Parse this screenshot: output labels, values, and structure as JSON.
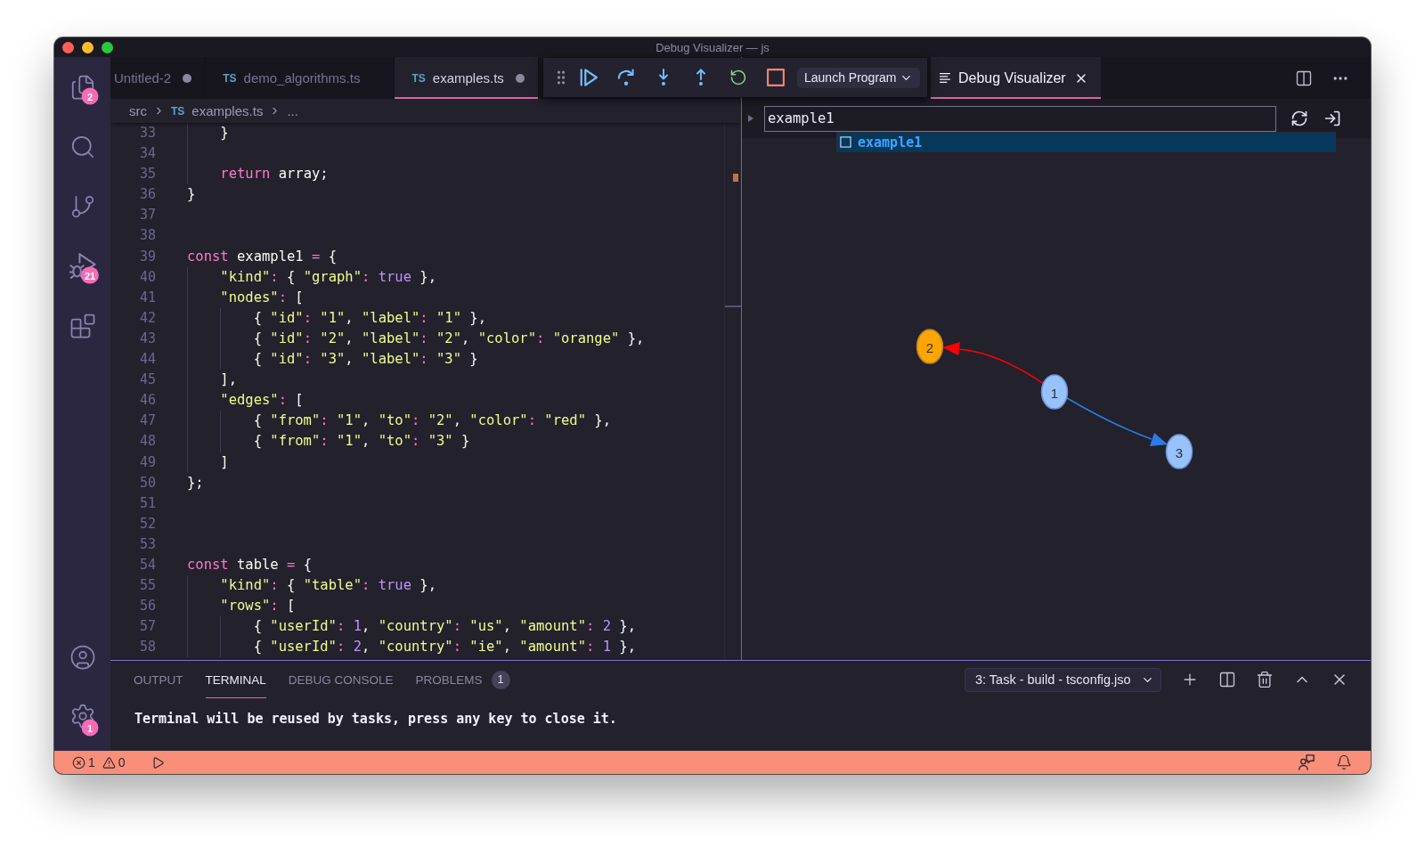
{
  "window": {
    "title": "Debug Visualizer — js",
    "controls": [
      {
        "kind": "close"
      },
      {
        "kind": "minimize"
      },
      {
        "kind": "maximize"
      }
    ]
  },
  "activity_bar": {
    "top": [
      {
        "kind": "explorer",
        "badge": "2"
      },
      {
        "kind": "search"
      },
      {
        "kind": "source-control"
      },
      {
        "kind": "run-debug",
        "badge": "21"
      },
      {
        "kind": "extensions"
      }
    ],
    "bottom": [
      {
        "kind": "accounts"
      },
      {
        "kind": "settings",
        "badge": "1"
      }
    ]
  },
  "editor_group": {
    "tabs": [
      {
        "label": "Untitled-2",
        "modified": true,
        "selected": false
      },
      {
        "file_type": "TS",
        "label": "demo_algorithms.ts",
        "modified": false,
        "selected": false
      },
      {
        "file_type": "TS",
        "label": "examples.ts",
        "modified": true,
        "selected": true
      }
    ],
    "breadcrumbs": [
      {
        "label": "src"
      },
      {
        "file_type": "TS",
        "label": "examples.ts"
      },
      {
        "label": "..."
      }
    ],
    "lines": [
      {
        "kind": "block",
        "children": [
          {
            "kind": "line",
            "number": "33",
            "tokens": [
              {
                "kind": "plain",
                "text": "}"
              }
            ]
          },
          {
            "kind": "line",
            "number": "34"
          },
          {
            "kind": "line",
            "number": "35",
            "tokens": [
              {
                "kind": "keyword",
                "text": "return"
              },
              {
                "kind": "plain",
                "text": " array;"
              }
            ]
          }
        ]
      },
      {
        "kind": "line",
        "number": "36",
        "tokens": [
          {
            "kind": "plain",
            "text": "}"
          }
        ]
      },
      {
        "kind": "line",
        "number": "37"
      },
      {
        "kind": "line",
        "number": "38"
      },
      {
        "kind": "line",
        "number": "39",
        "tokens": [
          {
            "kind": "keyword",
            "text": "const"
          },
          {
            "kind": "plain",
            "text": " example1 "
          },
          {
            "kind": "operator",
            "text": "="
          },
          {
            "kind": "plain",
            "text": " {"
          }
        ]
      },
      {
        "kind": "block",
        "children": [
          {
            "kind": "line",
            "number": "40",
            "tokens": [
              {
                "kind": "string",
                "text": "\"kind\""
              },
              {
                "kind": "operator",
                "text": ":"
              },
              {
                "kind": "plain",
                "text": " { "
              },
              {
                "kind": "string",
                "text": "\"graph\""
              },
              {
                "kind": "operator",
                "text": ":"
              },
              {
                "kind": "constant",
                "text": " true"
              },
              {
                "kind": "plain",
                "text": " },"
              }
            ]
          },
          {
            "kind": "line",
            "number": "41",
            "tokens": [
              {
                "kind": "string",
                "text": "\"nodes\""
              },
              {
                "kind": "operator",
                "text": ":"
              },
              {
                "kind": "plain",
                "text": " ["
              }
            ]
          },
          {
            "kind": "block",
            "children": [
              {
                "kind": "line",
                "number": "42",
                "tokens": [
                  {
                    "kind": "plain",
                    "text": "{ "
                  },
                  {
                    "kind": "string",
                    "text": "\"id\""
                  },
                  {
                    "kind": "operator",
                    "text": ":"
                  },
                  {
                    "kind": "string",
                    "text": " \"1\""
                  },
                  {
                    "kind": "plain",
                    "text": ", "
                  },
                  {
                    "kind": "string",
                    "text": "\"label\""
                  },
                  {
                    "kind": "operator",
                    "text": ":"
                  },
                  {
                    "kind": "string",
                    "text": " \"1\""
                  },
                  {
                    "kind": "plain",
                    "text": " },"
                  }
                ]
              },
              {
                "kind": "line",
                "number": "43",
                "tokens": [
                  {
                    "kind": "plain",
                    "text": "{ "
                  },
                  {
                    "kind": "string",
                    "text": "\"id\""
                  },
                  {
                    "kind": "operator",
                    "text": ":"
                  },
                  {
                    "kind": "string",
                    "text": " \"2\""
                  },
                  {
                    "kind": "plain",
                    "text": ", "
                  },
                  {
                    "kind": "string",
                    "text": "\"label\""
                  },
                  {
                    "kind": "operator",
                    "text": ":"
                  },
                  {
                    "kind": "string",
                    "text": " \"2\""
                  },
                  {
                    "kind": "plain",
                    "text": ", "
                  },
                  {
                    "kind": "string",
                    "text": "\"color\""
                  },
                  {
                    "kind": "operator",
                    "text": ":"
                  },
                  {
                    "kind": "string",
                    "text": " \"orange\""
                  },
                  {
                    "kind": "plain",
                    "text": " },"
                  }
                ]
              },
              {
                "kind": "line",
                "number": "44",
                "tokens": [
                  {
                    "kind": "plain",
                    "text": "{ "
                  },
                  {
                    "kind": "string",
                    "text": "\"id\""
                  },
                  {
                    "kind": "operator",
                    "text": ":"
                  },
                  {
                    "kind": "string",
                    "text": " \"3\""
                  },
                  {
                    "kind": "plain",
                    "text": ", "
                  },
                  {
                    "kind": "string",
                    "text": "\"label\""
                  },
                  {
                    "kind": "operator",
                    "text": ":"
                  },
                  {
                    "kind": "string",
                    "text": " \"3\""
                  },
                  {
                    "kind": "plain",
                    "text": " }"
                  }
                ]
              }
            ]
          },
          {
            "kind": "line",
            "number": "45",
            "tokens": [
              {
                "kind": "plain",
                "text": "],"
              }
            ]
          },
          {
            "kind": "line",
            "number": "46",
            "tokens": [
              {
                "kind": "string",
                "text": "\"edges\""
              },
              {
                "kind": "operator",
                "text": ":"
              },
              {
                "kind": "plain",
                "text": " ["
              }
            ]
          },
          {
            "kind": "block",
            "children": [
              {
                "kind": "line",
                "number": "47",
                "tokens": [
                  {
                    "kind": "plain",
                    "text": "{ "
                  },
                  {
                    "kind": "string",
                    "text": "\"from\""
                  },
                  {
                    "kind": "operator",
                    "text": ":"
                  },
                  {
                    "kind": "string",
                    "text": " \"1\""
                  },
                  {
                    "kind": "plain",
                    "text": ", "
                  },
                  {
                    "kind": "string",
                    "text": "\"to\""
                  },
                  {
                    "kind": "operator",
                    "text": ":"
                  },
                  {
                    "kind": "string",
                    "text": " \"2\""
                  },
                  {
                    "kind": "plain",
                    "text": ", "
                  },
                  {
                    "kind": "string",
                    "text": "\"color\""
                  },
                  {
                    "kind": "operator",
                    "text": ":"
                  },
                  {
                    "kind": "string",
                    "text": " \"red\""
                  },
                  {
                    "kind": "plain",
                    "text": " },"
                  }
                ]
              },
              {
                "kind": "line",
                "number": "48",
                "tokens": [
                  {
                    "kind": "plain",
                    "text": "{ "
                  },
                  {
                    "kind": "string",
                    "text": "\"from\""
                  },
                  {
                    "kind": "operator",
                    "text": ":"
                  },
                  {
                    "kind": "string",
                    "text": " \"1\""
                  },
                  {
                    "kind": "plain",
                    "text": ", "
                  },
                  {
                    "kind": "string",
                    "text": "\"to\""
                  },
                  {
                    "kind": "operator",
                    "text": ":"
                  },
                  {
                    "kind": "string",
                    "text": " \"3\""
                  },
                  {
                    "kind": "plain",
                    "text": " }"
                  }
                ]
              }
            ]
          },
          {
            "kind": "line",
            "number": "49",
            "tokens": [
              {
                "kind": "plain",
                "text": "]"
              }
            ]
          }
        ]
      },
      {
        "kind": "line",
        "number": "50",
        "tokens": [
          {
            "kind": "plain",
            "text": "};"
          }
        ]
      },
      {
        "kind": "line",
        "number": "51"
      },
      {
        "kind": "line",
        "number": "52"
      },
      {
        "kind": "line",
        "number": "53"
      },
      {
        "kind": "line",
        "number": "54",
        "tokens": [
          {
            "kind": "keyword",
            "text": "const"
          },
          {
            "kind": "plain",
            "text": " table "
          },
          {
            "kind": "operator",
            "text": "="
          },
          {
            "kind": "plain",
            "text": " {"
          }
        ]
      },
      {
        "kind": "block",
        "children": [
          {
            "kind": "line",
            "number": "55",
            "tokens": [
              {
                "kind": "string",
                "text": "\"kind\""
              },
              {
                "kind": "operator",
                "text": ":"
              },
              {
                "kind": "plain",
                "text": " { "
              },
              {
                "kind": "string",
                "text": "\"table\""
              },
              {
                "kind": "operator",
                "text": ":"
              },
              {
                "kind": "constant",
                "text": " true"
              },
              {
                "kind": "plain",
                "text": " },"
              }
            ]
          },
          {
            "kind": "line",
            "number": "56",
            "tokens": [
              {
                "kind": "string",
                "text": "\"rows\""
              },
              {
                "kind": "operator",
                "text": ":"
              },
              {
                "kind": "plain",
                "text": " ["
              }
            ]
          },
          {
            "kind": "block",
            "children": [
              {
                "kind": "line",
                "number": "57",
                "tokens": [
                  {
                    "kind": "plain",
                    "text": "{ "
                  },
                  {
                    "kind": "string",
                    "text": "\"userId\""
                  },
                  {
                    "kind": "operator",
                    "text": ":"
                  },
                  {
                    "kind": "constant",
                    "text": " 1"
                  },
                  {
                    "kind": "plain",
                    "text": ", "
                  },
                  {
                    "kind": "string",
                    "text": "\"country\""
                  },
                  {
                    "kind": "operator",
                    "text": ":"
                  },
                  {
                    "kind": "string",
                    "text": " \"us\""
                  },
                  {
                    "kind": "plain",
                    "text": ", "
                  },
                  {
                    "kind": "string",
                    "text": "\"amount\""
                  },
                  {
                    "kind": "operator",
                    "text": ":"
                  },
                  {
                    "kind": "constant",
                    "text": " 2"
                  },
                  {
                    "kind": "plain",
                    "text": " },"
                  }
                ]
              },
              {
                "kind": "line",
                "number": "58",
                "tokens": [
                  {
                    "kind": "plain",
                    "text": "{ "
                  },
                  {
                    "kind": "string",
                    "text": "\"userId\""
                  },
                  {
                    "kind": "operator",
                    "text": ":"
                  },
                  {
                    "kind": "constant",
                    "text": " 2"
                  },
                  {
                    "kind": "plain",
                    "text": ", "
                  },
                  {
                    "kind": "string",
                    "text": "\"country\""
                  },
                  {
                    "kind": "operator",
                    "text": ":"
                  },
                  {
                    "kind": "string",
                    "text": " \"ie\""
                  },
                  {
                    "kind": "plain",
                    "text": ", "
                  },
                  {
                    "kind": "string",
                    "text": "\"amount\""
                  },
                  {
                    "kind": "operator",
                    "text": ":"
                  },
                  {
                    "kind": "constant",
                    "text": " 1"
                  },
                  {
                    "kind": "plain",
                    "text": " },"
                  }
                ]
              }
            ]
          }
        ]
      }
    ]
  },
  "debug_toolbar": {
    "buttons": [
      {
        "kind": "continue"
      },
      {
        "kind": "step-over"
      },
      {
        "kind": "step-into"
      },
      {
        "kind": "step-out"
      },
      {
        "kind": "restart"
      },
      {
        "kind": "stop"
      }
    ],
    "configuration": "Launch Program"
  },
  "visualizer_group": {
    "tabs": [
      {
        "label": "Debug Visualizer",
        "selected": true
      }
    ],
    "expression": {
      "value": "example1"
    },
    "suggestions": [
      {
        "label": "example1",
        "selected": true
      }
    ],
    "graph": {
      "nodes": [
        {
          "label": "2",
          "color": "#ffa500"
        },
        {
          "label": "1",
          "color": "#97c2fc"
        },
        {
          "label": "3",
          "color": "#97c2fc"
        }
      ],
      "edges": [
        {
          "color": "#ff0000"
        },
        {
          "color": "#2b7ce9"
        }
      ]
    }
  },
  "panel": {
    "tabs": [
      {
        "label": "OUTPUT",
        "selected": false
      },
      {
        "label": "TERMINAL",
        "selected": true
      },
      {
        "label": "DEBUG CONSOLE",
        "selected": false
      },
      {
        "label": "PROBLEMS",
        "selected": false,
        "badge": "1"
      }
    ],
    "terminal_select": "3: Task - build - tsconfig.jso",
    "terminal_text": "Terminal will be reused by tasks, press any key to close it."
  },
  "status_bar": {
    "errors": "1",
    "warnings": "0"
  }
}
